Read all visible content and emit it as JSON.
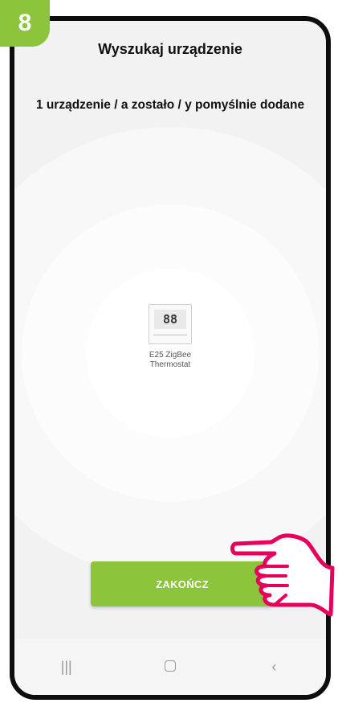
{
  "step_badge": "8",
  "header": {
    "title": "Wyszukaj urządzenie"
  },
  "status_message": "1 urządzenie / a zostało / y pomyślnie dodane",
  "device": {
    "name": "E25 ZigBee Thermostat",
    "display_value": "88"
  },
  "finish_button": {
    "label": "ZAKOŃCZ"
  },
  "navbar": {
    "recent": "|||",
    "back": "‹"
  },
  "colors": {
    "accent": "#8cc43c",
    "pointer": "#e6005c"
  }
}
